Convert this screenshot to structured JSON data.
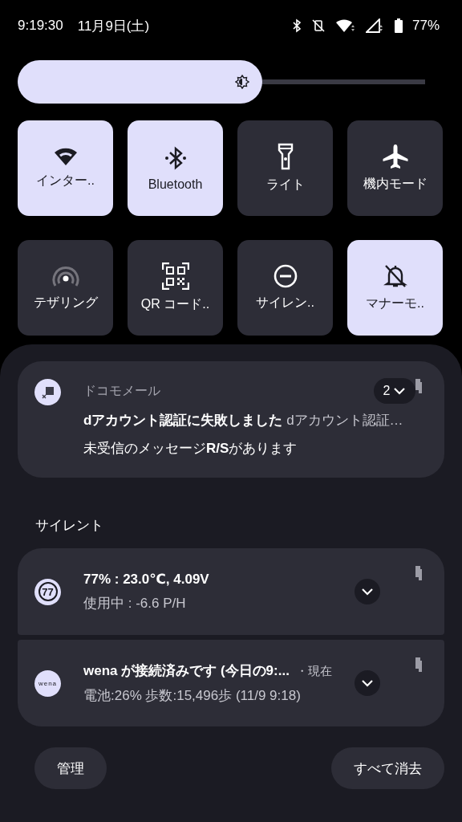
{
  "status_bar": {
    "time": "9:19:30",
    "date": "11月9日(土)",
    "battery": "77%"
  },
  "brightness": {
    "level": 0.6
  },
  "tiles": [
    {
      "label": "インター..",
      "on": true,
      "kind": "wifi"
    },
    {
      "label": "Bluetooth",
      "on": true,
      "kind": "bluetooth"
    },
    {
      "label": "ライト",
      "on": false,
      "kind": "flashlight"
    },
    {
      "label": "機内モード",
      "on": false,
      "kind": "airplane"
    },
    {
      "label": "テザリング",
      "on": false,
      "kind": "hotspot"
    },
    {
      "label": "QR コード..",
      "on": false,
      "kind": "qr"
    },
    {
      "label": "サイレン..",
      "on": false,
      "kind": "dnd"
    },
    {
      "label": "マナーモ..",
      "on": true,
      "kind": "bell"
    }
  ],
  "notification": {
    "app": "ドコモメール",
    "count": "2",
    "title": "dアカウント認証に失敗しました",
    "preview": "dアカウント認証…",
    "body": "未受信のメッセージ**R/S**があります"
  },
  "section_title": "サイレント",
  "silent_notifications": [
    {
      "icon_text": "77",
      "title": "77% : 23.0℃, 4.09V",
      "body": "使用中 : -6.6 P/H"
    },
    {
      "icon_text": "wena",
      "title": "wena が接続済みです (今日の9:...",
      "time": "・現在",
      "body": "電池:26% 歩数:15,496歩 (11/9 9:18)"
    }
  ],
  "buttons": {
    "manage": "管理",
    "clear_all": "すべて消去"
  }
}
